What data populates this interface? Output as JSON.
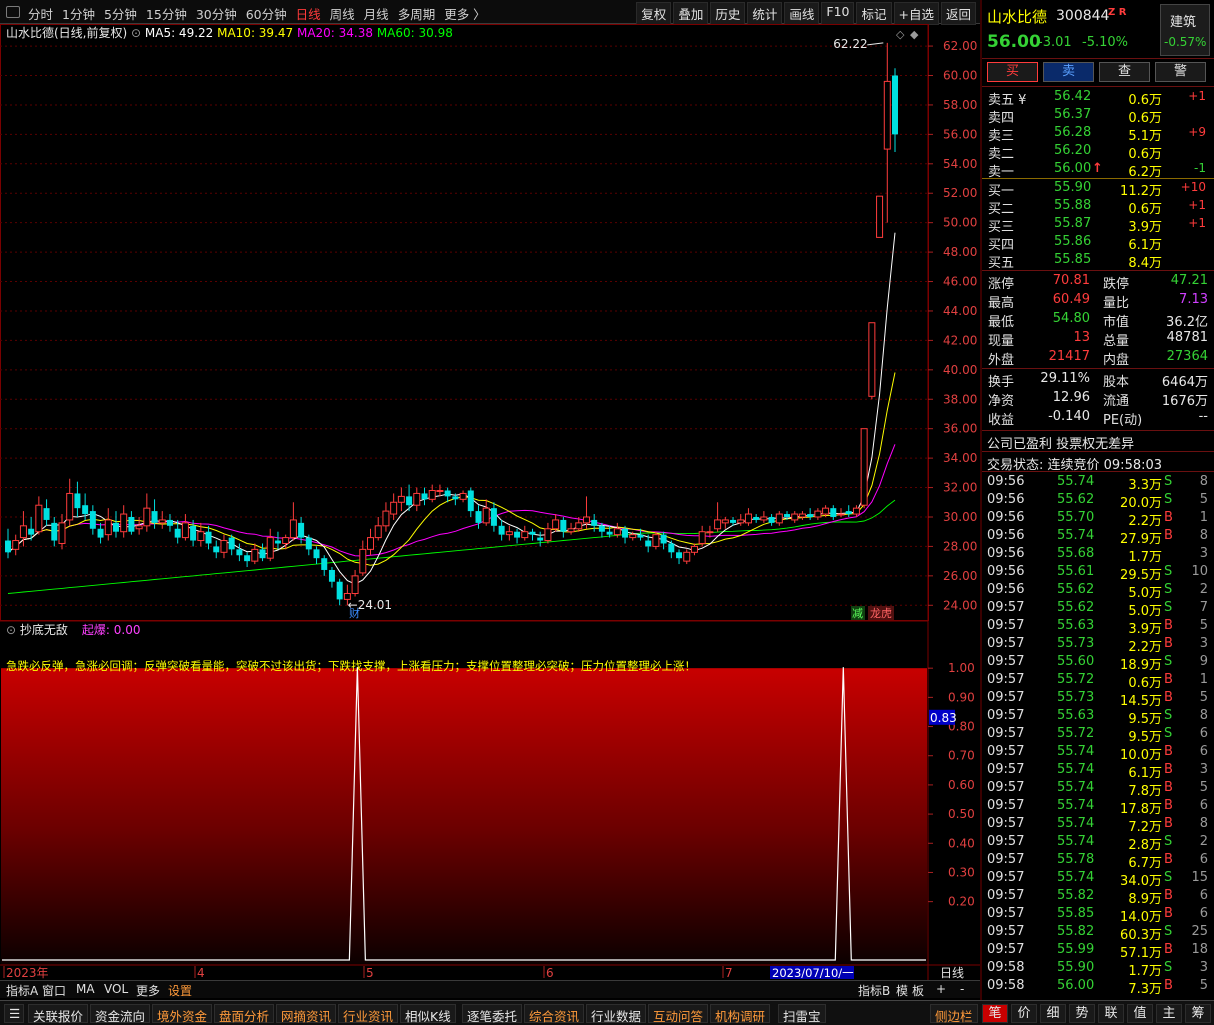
{
  "toolbar": {
    "periods": [
      "分时",
      "1分钟",
      "5分钟",
      "15分钟",
      "30分钟",
      "60分钟",
      "日线",
      "周线",
      "月线",
      "多周期",
      "更多 〉"
    ],
    "active_period": "日线",
    "tools": [
      "复权",
      "叠加",
      "历史",
      "统计",
      "画线",
      "F10",
      "标记",
      "+自选",
      "返回"
    ]
  },
  "chart_info": {
    "name_label": "山水比德(日线,前复权)",
    "ma5": "MA5: 49.22",
    "ma10": "MA10: 39.47",
    "ma20": "MA20: 34.38",
    "ma60": "MA60: 30.98",
    "high_mark": "62.22",
    "low_mark": "24.01",
    "event_cai": "财",
    "event_jian": "减",
    "event_longhu": "龙虎",
    "colors": {
      "ma5": "#ffffff",
      "ma10": "#ffff00",
      "ma20": "#ff00ff",
      "ma60": "#00ff00",
      "up": "#ff3c3c",
      "down": "#00e0e0"
    }
  },
  "chart_data": [
    {
      "type": "candlestick",
      "title": "山水比德(日线,前复权)",
      "ylim": [
        23,
        63.5
      ],
      "y_ticks": [
        "62.00",
        "60.00",
        "58.00",
        "56.00",
        "54.00",
        "52.00",
        "50.00",
        "48.00",
        "46.00",
        "44.00",
        "42.00",
        "40.00",
        "38.00",
        "36.00",
        "34.00",
        "32.00",
        "30.00",
        "28.00",
        "26.00",
        "24.00"
      ],
      "x_ticks": [
        "2023年",
        "4",
        "5",
        "6",
        "7",
        "2023/07/10/一"
      ],
      "series": [
        {
          "name": "MA5"
        },
        {
          "name": "MA10"
        },
        {
          "name": "MA20"
        },
        {
          "name": "MA60"
        }
      ],
      "candles": [
        [
          28.4,
          27.6,
          29.2,
          27.2
        ],
        [
          27.8,
          28.4,
          28.8,
          27.4
        ],
        [
          28.6,
          29.4,
          30.4,
          28.0
        ],
        [
          29.2,
          28.8,
          30.0,
          28.4
        ],
        [
          29.0,
          30.8,
          31.4,
          28.8
        ],
        [
          30.6,
          29.8,
          31.2,
          29.4
        ],
        [
          29.6,
          28.4,
          30.0,
          28.0
        ],
        [
          28.2,
          29.6,
          30.2,
          27.8
        ],
        [
          29.8,
          31.6,
          32.6,
          29.4
        ],
        [
          31.6,
          30.6,
          32.4,
          30.0
        ],
        [
          30.8,
          30.2,
          31.6,
          29.8
        ],
        [
          30.4,
          29.2,
          30.8,
          28.8
        ],
        [
          29.2,
          28.6,
          29.6,
          28.2
        ],
        [
          28.8,
          29.8,
          30.6,
          28.4
        ],
        [
          29.6,
          29.0,
          30.4,
          28.6
        ],
        [
          29.0,
          30.2,
          30.8,
          28.6
        ],
        [
          30.0,
          29.0,
          30.4,
          28.8
        ],
        [
          29.2,
          29.4,
          30.0,
          28.8
        ],
        [
          29.4,
          30.6,
          31.6,
          29.0
        ],
        [
          30.4,
          29.6,
          31.2,
          29.2
        ],
        [
          29.6,
          29.8,
          30.4,
          29.2
        ],
        [
          29.8,
          29.4,
          30.2,
          29.0
        ],
        [
          29.2,
          28.6,
          29.8,
          28.2
        ],
        [
          28.6,
          29.6,
          30.2,
          28.4
        ],
        [
          29.4,
          28.4,
          29.8,
          28.0
        ],
        [
          28.4,
          29.0,
          29.6,
          28.0
        ],
        [
          29.0,
          28.2,
          29.4,
          27.8
        ],
        [
          28.0,
          27.6,
          28.4,
          27.2
        ],
        [
          27.6,
          28.4,
          28.8,
          27.2
        ],
        [
          28.6,
          27.8,
          28.8,
          27.4
        ],
        [
          27.8,
          27.4,
          28.2,
          27.0
        ],
        [
          27.4,
          27.0,
          27.6,
          26.6
        ],
        [
          27.0,
          27.8,
          28.2,
          26.8
        ],
        [
          27.8,
          27.2,
          28.2,
          27.0
        ],
        [
          27.2,
          28.6,
          29.2,
          27.0
        ],
        [
          28.4,
          28.2,
          29.0,
          27.8
        ],
        [
          28.2,
          28.6,
          28.8,
          27.8
        ],
        [
          28.6,
          29.8,
          31.0,
          28.4
        ],
        [
          29.6,
          28.6,
          30.0,
          28.2
        ],
        [
          28.6,
          27.8,
          28.8,
          27.4
        ],
        [
          27.8,
          27.2,
          28.0,
          26.8
        ],
        [
          27.2,
          26.4,
          27.4,
          26.0
        ],
        [
          26.4,
          25.6,
          26.6,
          25.2
        ],
        [
          25.6,
          24.4,
          25.8,
          24.0
        ],
        [
          24.4,
          24.8,
          25.4,
          24.0
        ],
        [
          24.8,
          26.0,
          26.4,
          24.6
        ],
        [
          26.2,
          27.8,
          28.4,
          26.0
        ],
        [
          27.8,
          28.6,
          29.2,
          27.4
        ],
        [
          28.6,
          29.4,
          30.0,
          28.4
        ],
        [
          29.4,
          30.4,
          31.0,
          29.0
        ],
        [
          30.2,
          31.0,
          31.6,
          29.8
        ],
        [
          31.0,
          31.4,
          32.0,
          30.4
        ],
        [
          31.4,
          30.8,
          32.2,
          30.4
        ],
        [
          30.8,
          31.6,
          32.0,
          30.4
        ],
        [
          31.6,
          31.2,
          32.0,
          30.8
        ],
        [
          31.2,
          31.8,
          32.2,
          31.0
        ],
        [
          31.8,
          31.8,
          32.2,
          31.4
        ],
        [
          31.8,
          31.4,
          32.0,
          31.0
        ],
        [
          31.4,
          31.2,
          31.6,
          30.8
        ],
        [
          31.2,
          31.6,
          31.8,
          31.0
        ],
        [
          31.8,
          30.4,
          32.0,
          30.0
        ],
        [
          30.4,
          29.6,
          30.8,
          29.2
        ],
        [
          29.6,
          30.6,
          31.2,
          29.4
        ],
        [
          30.6,
          29.4,
          31.0,
          29.0
        ],
        [
          29.4,
          28.8,
          29.8,
          28.4
        ],
        [
          28.8,
          29.0,
          29.4,
          28.4
        ],
        [
          29.0,
          28.6,
          29.2,
          28.2
        ],
        [
          28.6,
          29.0,
          29.4,
          28.4
        ],
        [
          29.0,
          28.8,
          29.2,
          28.4
        ],
        [
          28.6,
          28.4,
          29.0,
          28.0
        ],
        [
          28.4,
          29.2,
          29.6,
          28.2
        ],
        [
          29.2,
          29.8,
          30.2,
          29.0
        ],
        [
          29.8,
          29.0,
          30.0,
          28.6
        ],
        [
          29.0,
          29.2,
          29.6,
          28.8
        ],
        [
          29.2,
          29.6,
          30.0,
          29.0
        ],
        [
          29.6,
          30.0,
          31.4,
          29.2
        ],
        [
          29.8,
          29.4,
          30.2,
          29.0
        ],
        [
          29.4,
          29.0,
          29.6,
          28.6
        ],
        [
          29.0,
          28.8,
          29.4,
          28.6
        ],
        [
          28.8,
          29.2,
          29.6,
          28.6
        ],
        [
          29.2,
          28.6,
          29.4,
          28.2
        ],
        [
          28.6,
          28.8,
          29.0,
          28.4
        ],
        [
          28.8,
          28.6,
          29.2,
          28.4
        ],
        [
          28.4,
          28.0,
          28.8,
          27.6
        ],
        [
          28.0,
          28.8,
          29.0,
          27.8
        ],
        [
          28.8,
          28.2,
          29.0,
          27.8
        ],
        [
          28.2,
          27.6,
          28.4,
          27.2
        ],
        [
          27.6,
          27.2,
          27.8,
          26.8
        ],
        [
          27.0,
          27.6,
          27.8,
          26.8
        ],
        [
          27.6,
          28.0,
          28.2,
          27.4
        ],
        [
          28.2,
          29.0,
          29.4,
          28.0
        ],
        [
          29.0,
          29.0,
          29.4,
          28.6
        ],
        [
          29.2,
          29.8,
          31.0,
          29.0
        ],
        [
          29.6,
          29.8,
          30.0,
          29.2
        ],
        [
          29.8,
          29.6,
          30.0,
          29.4
        ],
        [
          29.6,
          29.8,
          30.2,
          29.4
        ],
        [
          29.6,
          30.2,
          30.6,
          29.4
        ],
        [
          30.0,
          29.8,
          30.2,
          29.6
        ],
        [
          29.8,
          30.0,
          30.4,
          29.6
        ],
        [
          30.0,
          29.6,
          30.2,
          29.4
        ],
        [
          29.6,
          30.2,
          30.4,
          29.4
        ],
        [
          30.2,
          30.0,
          30.4,
          29.8
        ],
        [
          29.8,
          30.2,
          30.4,
          29.6
        ],
        [
          30.0,
          30.2,
          30.4,
          29.8
        ],
        [
          30.2,
          30.0,
          30.6,
          29.8
        ],
        [
          30.0,
          30.4,
          30.6,
          29.8
        ],
        [
          30.2,
          30.6,
          30.8,
          30.0
        ],
        [
          30.6,
          30.0,
          30.8,
          29.8
        ],
        [
          30.2,
          30.2,
          30.6,
          30.0
        ],
        [
          30.4,
          30.2,
          30.8,
          30.0
        ],
        [
          30.2,
          30.6,
          30.8,
          30.0
        ],
        [
          30.8,
          36.0,
          36.0,
          30.6
        ],
        [
          38.2,
          43.2,
          43.2,
          38.0
        ],
        [
          49.0,
          51.8,
          51.8,
          49.0
        ],
        [
          55.0,
          59.6,
          62.22,
          50.0
        ],
        [
          60.0,
          56.0,
          60.49,
          54.8
        ]
      ]
    },
    {
      "type": "line",
      "title": "抄底无敌",
      "legend_label": "起爆: 0.00",
      "ylim": [
        0,
        1.1
      ],
      "y_ticks": [
        "1.00",
        "0.90",
        "0.80",
        "0.70",
        "0.60",
        "0.50",
        "0.40",
        "0.30",
        "0.20"
      ],
      "current_value": "0.83",
      "spike_indexes": [
        44,
        107
      ],
      "banner_text": "急跌必反弹，急涨必回调；反弹突破看量能，突破不过该出货；下跌找支撑，上涨看压力；支撑位置整理必突破；压力位置整理必上涨！"
    }
  ],
  "stock": {
    "name": "山水比德",
    "code": "300844",
    "tag": "Z R",
    "price": "56.00",
    "change": "-3.01",
    "pct": "-5.10%",
    "sector": "建筑",
    "sector_pct": "-0.57%"
  },
  "trade_buttons": [
    "买",
    "卖",
    "查",
    "警"
  ],
  "order_book": {
    "asks": [
      {
        "label": "卖五 ¥",
        "price": "56.42",
        "vol": "0.6万",
        "chg": "+1"
      },
      {
        "label": "卖四",
        "price": "56.37",
        "vol": "0.6万",
        "chg": ""
      },
      {
        "label": "卖三",
        "price": "56.28",
        "vol": "5.1万",
        "chg": "+9"
      },
      {
        "label": "卖二",
        "price": "56.20",
        "vol": "0.6万",
        "chg": ""
      },
      {
        "label": "卖一",
        "price": "56.00",
        "vol": "6.2万",
        "chg": "-1"
      }
    ],
    "bids": [
      {
        "label": "买一",
        "price": "55.90",
        "vol": "11.2万",
        "chg": "+10"
      },
      {
        "label": "买二",
        "price": "55.88",
        "vol": "0.6万",
        "chg": "+1"
      },
      {
        "label": "买三",
        "price": "55.87",
        "vol": "3.9万",
        "chg": "+1"
      },
      {
        "label": "买四",
        "price": "55.86",
        "vol": "6.1万",
        "chg": ""
      },
      {
        "label": "买五",
        "price": "55.85",
        "vol": "8.4万",
        "chg": ""
      }
    ]
  },
  "stats": {
    "l1": "涨停",
    "v1": "70.81",
    "l2": "跌停",
    "v2": "47.21",
    "l3": "最高",
    "v3": "60.49",
    "l4": "量比",
    "v4": "7.13",
    "l5": "最低",
    "v5": "54.80",
    "l6": "市值",
    "v6": "36.2亿",
    "l7": "现量",
    "v7": "13",
    "l8": "总量",
    "v8": "48781",
    "l9": "外盘",
    "v9": "21417",
    "l10": "内盘",
    "v10": "27364",
    "l11": "换手",
    "v11": "29.11%",
    "l12": "股本",
    "v12": "6464万",
    "l13": "净资",
    "v13": "12.96",
    "l14": "流通",
    "v14": "1676万",
    "l15": "收益",
    "v15": "-0.140",
    "l16": "PE(动)",
    "v16": "--"
  },
  "company_note": "公司已盈利 投票权无差异",
  "trade_status": "交易状态: 连续竞价 09:58:03",
  "ticks": [
    [
      "09:56",
      "55.74",
      "3.3万",
      "S",
      "8"
    ],
    [
      "09:56",
      "55.62",
      "20.0万",
      "S",
      "5"
    ],
    [
      "09:56",
      "55.70",
      "2.2万",
      "B",
      "1"
    ],
    [
      "09:56",
      "55.74",
      "27.9万",
      "B",
      "8"
    ],
    [
      "09:56",
      "55.68",
      "1.7万",
      "",
      "3"
    ],
    [
      "09:56",
      "55.61",
      "29.5万",
      "S",
      "10"
    ],
    [
      "09:56",
      "55.62",
      "5.0万",
      "S",
      "2"
    ],
    [
      "09:57",
      "55.62",
      "5.0万",
      "S",
      "7"
    ],
    [
      "09:57",
      "55.63",
      "3.9万",
      "B",
      "5"
    ],
    [
      "09:57",
      "55.73",
      "2.2万",
      "B",
      "3"
    ],
    [
      "09:57",
      "55.60",
      "18.9万",
      "S",
      "9"
    ],
    [
      "09:57",
      "55.72",
      "0.6万",
      "B",
      "1"
    ],
    [
      "09:57",
      "55.73",
      "14.5万",
      "B",
      "5"
    ],
    [
      "09:57",
      "55.63",
      "9.5万",
      "S",
      "8"
    ],
    [
      "09:57",
      "55.72",
      "9.5万",
      "S",
      "6"
    ],
    [
      "09:57",
      "55.74",
      "10.0万",
      "B",
      "6"
    ],
    [
      "09:57",
      "55.74",
      "6.1万",
      "B",
      "3"
    ],
    [
      "09:57",
      "55.74",
      "7.8万",
      "B",
      "5"
    ],
    [
      "09:57",
      "55.74",
      "17.8万",
      "B",
      "6"
    ],
    [
      "09:57",
      "55.74",
      "7.2万",
      "B",
      "8"
    ],
    [
      "09:57",
      "55.74",
      "2.8万",
      "S",
      "2"
    ],
    [
      "09:57",
      "55.78",
      "6.7万",
      "B",
      "6"
    ],
    [
      "09:57",
      "55.74",
      "34.0万",
      "S",
      "15"
    ],
    [
      "09:57",
      "55.82",
      "8.9万",
      "B",
      "6"
    ],
    [
      "09:57",
      "55.85",
      "14.0万",
      "B",
      "6"
    ],
    [
      "09:57",
      "55.82",
      "60.3万",
      "S",
      "25"
    ],
    [
      "09:57",
      "55.99",
      "57.1万",
      "B",
      "18"
    ],
    [
      "09:58",
      "55.90",
      "1.7万",
      "S",
      "3"
    ],
    [
      "09:58",
      "56.00",
      "7.3万",
      "B",
      "5"
    ]
  ],
  "indicator_tabs": [
    "指标A",
    "窗口",
    "MA",
    "VOL",
    "更多",
    "设置"
  ],
  "indicator_right": [
    "指标B",
    "模",
    "板",
    "+",
    "-"
  ],
  "period_label": "日线",
  "bottom_buttons": [
    {
      "label": "关联报价",
      "orange": false
    },
    {
      "label": "资金流向",
      "orange": false
    },
    {
      "label": "境外资金",
      "orange": true
    },
    {
      "label": "盘面分析",
      "orange": true
    },
    {
      "label": "网摘资讯",
      "orange": true
    },
    {
      "label": "行业资讯",
      "orange": true
    },
    {
      "label": "相似K线",
      "orange": false
    },
    {
      "label": "逐笔委托",
      "orange": false
    },
    {
      "label": "综合资讯",
      "orange": true
    },
    {
      "label": "行业数据",
      "orange": false
    },
    {
      "label": "互动问答",
      "orange": true
    },
    {
      "label": "机构调研",
      "orange": true
    },
    {
      "label": "扫雷宝",
      "orange": false
    },
    {
      "label": "侧边栏",
      "orange": true
    }
  ],
  "right_tabs": [
    "笔",
    "价",
    "细",
    "势",
    "联",
    "值",
    "主",
    "筹"
  ]
}
